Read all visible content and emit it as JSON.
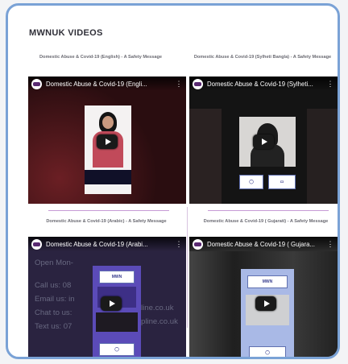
{
  "section": {
    "title": "MWNUK VIDEOS"
  },
  "videos": [
    {
      "caption": "Domestic Abuse & Covid-19 (English) - A Safety Message",
      "player_title": "Domestic Abuse & Covid-19 (Engli..."
    },
    {
      "caption": "Domestic Abuse & Covid-19 (Sylheti Bangla) - A Safety Message",
      "player_title": "Domestic Abuse & Covid-19 (Sylheti..."
    },
    {
      "caption": "Domestic Abuse & Covid-19 (Arabic) - A Safety Message",
      "player_title": "Domestic Abuse & Covid-19 (Arabi..."
    },
    {
      "caption": "Domestic Abuse & Covid-19 ( Gujarati) - A Safety Message",
      "player_title": "Domestic Abuse & Covid-19 ( Gujara..."
    }
  ],
  "arabic_overlay": {
    "lines": [
      "Open Mon-",
      "Call us: 08",
      "Email us: in",
      "Chat to us:",
      "Text us: 07"
    ],
    "right_fragments": [
      "line.co.uk",
      "pline.co.uk"
    ]
  },
  "colors": {
    "frame_border": "#7aa2d6",
    "separator": "#c69ad6",
    "video_bg": "#1b1b1f"
  }
}
